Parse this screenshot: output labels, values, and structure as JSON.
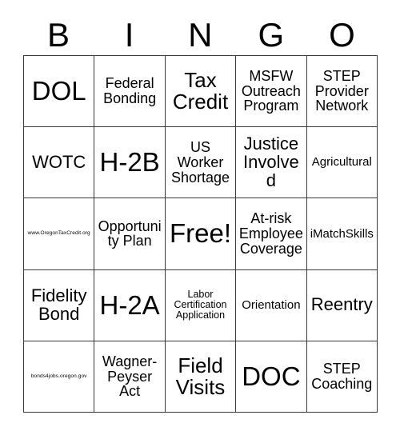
{
  "card": {
    "type": "bingo-card",
    "header_letters": [
      "B",
      "I",
      "N",
      "G",
      "O"
    ],
    "grid_size": "5x5",
    "free_space": "Free!",
    "colors": {
      "background": "#ffffff",
      "text": "#000000",
      "grid_line": "#3a3a3a"
    },
    "rows": [
      [
        {
          "text": "DOL",
          "size": "xxl"
        },
        {
          "text": "Federal Bonding",
          "size": "md"
        },
        {
          "text": "Tax Credit",
          "size": "xl"
        },
        {
          "text": "MSFW Outreach Program",
          "size": "md"
        },
        {
          "text": "STEP Provider Network",
          "size": "md"
        }
      ],
      [
        {
          "text": "WOTC",
          "size": "lg"
        },
        {
          "text": "H-2B",
          "size": "xxl"
        },
        {
          "text": "US Worker Shortage",
          "size": "md"
        },
        {
          "text": "Justice Involved",
          "size": "lg"
        },
        {
          "text": "Agricultural",
          "size": "sm"
        }
      ],
      [
        {
          "text": "www.OregonTaxCredit.org",
          "size": "tiny"
        },
        {
          "text": "Opportunity Plan",
          "size": "md"
        },
        {
          "text": "Free!",
          "size": "xxl"
        },
        {
          "text": "At-risk Employee Coverage",
          "size": "md"
        },
        {
          "text": "iMatchSkills",
          "size": "sm"
        }
      ],
      [
        {
          "text": "Fidelity Bond",
          "size": "lg"
        },
        {
          "text": "H-2A",
          "size": "xxl"
        },
        {
          "text": "Labor Certification Application",
          "size": "xs"
        },
        {
          "text": "Orientation",
          "size": "sm"
        },
        {
          "text": "Reentry",
          "size": "lg"
        }
      ],
      [
        {
          "text": "bonds4jobs.oregon.gov",
          "size": "tiny"
        },
        {
          "text": "Wagner-Peyser Act",
          "size": "md"
        },
        {
          "text": "Field Visits",
          "size": "xl"
        },
        {
          "text": "DOC",
          "size": "xxl"
        },
        {
          "text": "STEP Coaching",
          "size": "md"
        }
      ]
    ]
  }
}
